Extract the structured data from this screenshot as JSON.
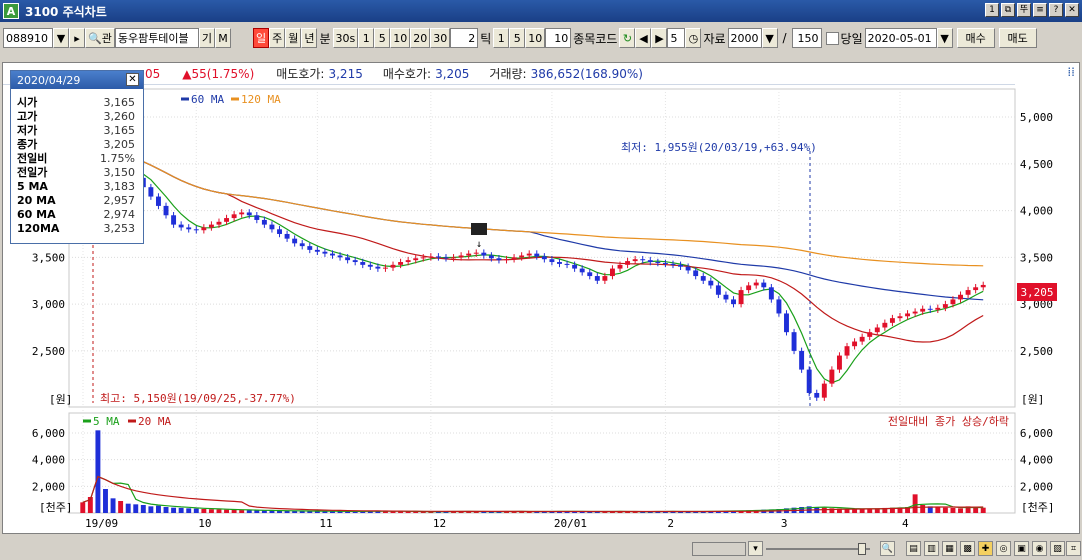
{
  "window": {
    "title": "3100 주식차트",
    "buttons": [
      "1",
      "⧉",
      "뚜",
      "≡",
      "?",
      "✕"
    ]
  },
  "toolbar": {
    "code": "088910",
    "code_search": "관",
    "name": "동우팜투테이블",
    "name_btn": "기",
    "m_btn": "M",
    "periods": [
      "일",
      "주",
      "월",
      "년"
    ],
    "minute_label": "분",
    "minute_value": "30s",
    "minute_opts": [
      "1",
      "5",
      "10",
      "20",
      "30"
    ],
    "count_value": "2",
    "tick_label": "틱",
    "tick_opts": [
      "1",
      "5",
      "10"
    ],
    "tick_value": "10",
    "code_label": "종목코드",
    "step_value": "5",
    "data_label": "자료",
    "data_value": "2000",
    "slash": "/",
    "page_value": "150",
    "today_label": "당일",
    "date_value": "2020-05-01",
    "buy_label": "매수",
    "sell_label": "매도"
  },
  "info": {
    "price_tail": "05",
    "change": "▲55(1.75%)",
    "ask_label": "매도호가:",
    "ask_value": "3,215",
    "bid_label": "매수호가:",
    "bid_value": "3,205",
    "vol_label": "거래량:",
    "vol_value": "386,652(168.90%)"
  },
  "legend": {
    "ma60": "60 MA",
    "ma120": "120 MA",
    "vol_ma5": "5 MA",
    "vol_ma20": "20 MA",
    "vol_note": "전일대비 종가 상승/하락"
  },
  "popup": {
    "date": "2020/04/29",
    "close": "✕",
    "rows": [
      {
        "k": "시가",
        "v": "3,165"
      },
      {
        "k": "고가",
        "v": "3,260"
      },
      {
        "k": "저가",
        "v": "3,165"
      },
      {
        "k": "종가",
        "v": "3,205"
      },
      {
        "k": "전일비",
        "v": "1.75%"
      },
      {
        "k": "전일가",
        "v": "3,150"
      },
      {
        "k": "5  MA",
        "v": "3,183"
      },
      {
        "k": "20 MA",
        "v": "2,957"
      },
      {
        "k": "60 MA",
        "v": "2,974"
      },
      {
        "k": "120MA",
        "v": "3,253"
      }
    ]
  },
  "annotations": {
    "low": "최저: 1,955원(20/03/19,+63.94%)",
    "high": "최고: 5,150원(19/09/25,-37.77%)",
    "current_price": "3,205",
    "price_unit": "[원]",
    "vol_unit": "[천주]"
  },
  "chart_data": {
    "type": "candlestick",
    "price_axis": {
      "ticks": [
        "5,000",
        "4,500",
        "4,000",
        "3,500",
        "3,000",
        "2,500"
      ],
      "ylim": [
        1900,
        5300
      ]
    },
    "volume_axis": {
      "ticks": [
        "6,000",
        "4,000",
        "2,000"
      ],
      "ylim": [
        0,
        7500
      ]
    },
    "x_labels": [
      "19/09",
      "10",
      "11",
      "12",
      "20/01",
      "2",
      "3",
      "4"
    ],
    "colors": {
      "up": "#e0102a",
      "down": "#1f2fd8",
      "ma5": "#1aa01a",
      "ma20": "#c01a1a",
      "ma60": "#1f3aa8",
      "ma120": "#e89020"
    },
    "close_series": [
      4700,
      4850,
      4650,
      4550,
      4450,
      4500,
      4400,
      4350,
      4250,
      4150,
      4050,
      3950,
      3850,
      3820,
      3800,
      3790,
      3820,
      3850,
      3880,
      3920,
      3960,
      3980,
      3950,
      3900,
      3850,
      3800,
      3750,
      3700,
      3650,
      3620,
      3580,
      3560,
      3540,
      3520,
      3500,
      3470,
      3450,
      3420,
      3400,
      3380,
      3390,
      3420,
      3450,
      3470,
      3490,
      3500,
      3510,
      3500,
      3490,
      3500,
      3520,
      3540,
      3550,
      3520,
      3490,
      3470,
      3480,
      3500,
      3520,
      3540,
      3510,
      3480,
      3450,
      3430,
      3420,
      3380,
      3340,
      3300,
      3250,
      3300,
      3380,
      3420,
      3460,
      3480,
      3470,
      3450,
      3440,
      3430,
      3420,
      3400,
      3360,
      3300,
      3250,
      3200,
      3100,
      3050,
      3000,
      3150,
      3200,
      3230,
      3180,
      3050,
      2900,
      2700,
      2500,
      2300,
      2050,
      2000,
      2150,
      2300,
      2450,
      2550,
      2600,
      2650,
      2700,
      2750,
      2800,
      2850,
      2870,
      2900,
      2920,
      2950,
      2940,
      2960,
      3000,
      3050,
      3100,
      3150,
      3180,
      3205
    ],
    "volume_series": [
      800,
      1200,
      6200,
      1800,
      1100,
      900,
      700,
      650,
      600,
      500,
      550,
      450,
      400,
      380,
      350,
      330,
      300,
      280,
      260,
      250,
      230,
      220,
      200,
      190,
      180,
      170,
      160,
      150,
      150,
      140,
      140,
      130,
      130,
      120,
      120,
      110,
      120,
      130,
      140,
      150,
      140,
      130,
      120,
      110,
      110,
      100,
      100,
      110,
      120,
      130,
      120,
      110,
      100,
      100,
      110,
      120,
      130,
      120,
      110,
      100,
      110,
      120,
      130,
      140,
      120,
      110,
      100,
      110,
      120,
      130,
      120,
      110,
      100,
      100,
      110,
      120,
      130,
      120,
      110,
      100,
      110,
      120,
      130,
      140,
      150,
      160,
      170,
      180,
      200,
      220,
      250,
      270,
      300,
      350,
      400,
      450,
      500,
      450,
      400,
      350,
      320,
      300,
      280,
      300,
      320,
      350,
      380,
      400,
      420,
      450,
      1400,
      600,
      500,
      450,
      400,
      380,
      350,
      500,
      450,
      400
    ]
  }
}
